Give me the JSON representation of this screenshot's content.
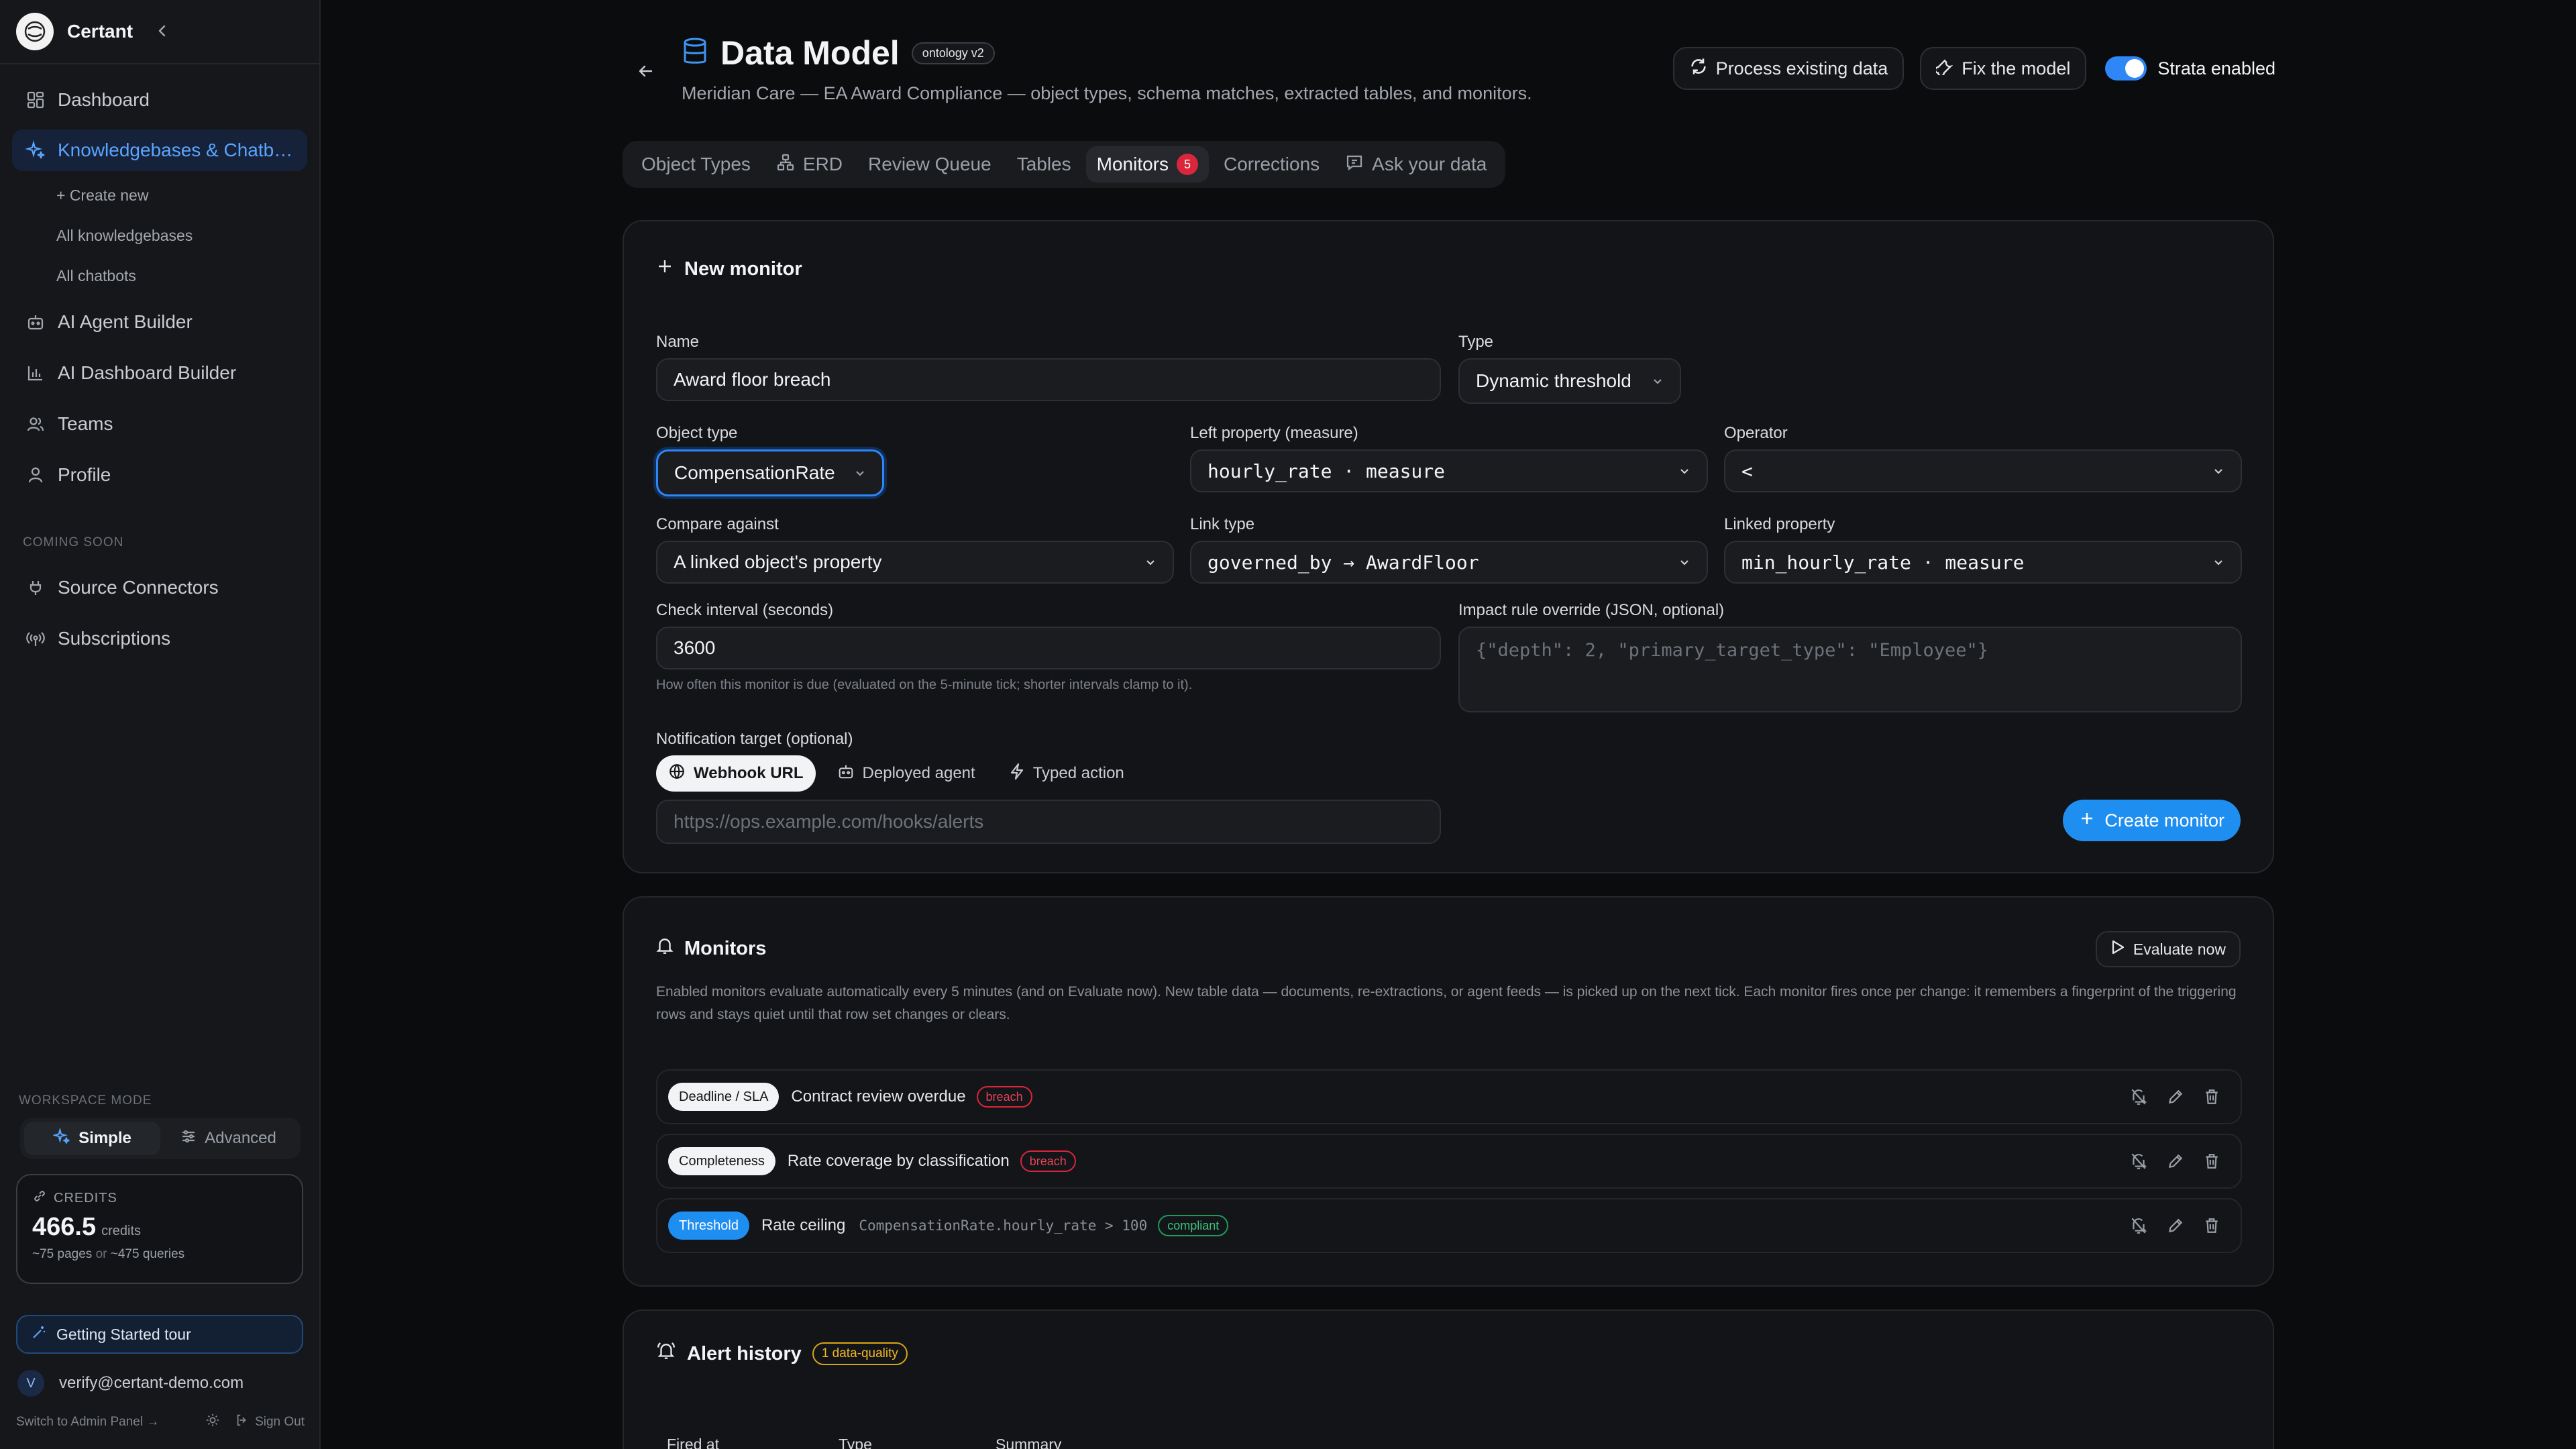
{
  "sidebar": {
    "brand": "Certant",
    "nav": [
      {
        "label": "Dashboard"
      },
      {
        "label": "Knowledgebases & Chatb…"
      },
      {
        "label": "AI Agent Builder"
      },
      {
        "label": "AI Dashboard Builder"
      },
      {
        "label": "Teams"
      },
      {
        "label": "Profile"
      },
      {
        "label": "Source Connectors"
      },
      {
        "label": "Subscriptions"
      }
    ],
    "sub_items": [
      "+ Create new",
      "All knowledgebases",
      "All chatbots"
    ],
    "coming_soon_label": "COMING SOON",
    "workspace_mode_label": "WORKSPACE MODE",
    "mode_simple": "Simple",
    "mode_advanced": "Advanced",
    "credits": {
      "label": "CREDITS",
      "value": "466.5",
      "unit": "credits",
      "pages": "~75 pages",
      "or": "or",
      "queries": "~475 queries"
    },
    "tour_label": "Getting Started tour",
    "user_initial": "V",
    "user_email": "verify@certant-demo.com",
    "switch_admin": "Switch to Admin Panel →",
    "sign_out": "Sign Out"
  },
  "header": {
    "title": "Data Model",
    "version_badge": "ontology v2",
    "subtitle": "Meridian Care — EA Award Compliance — object types, schema matches, extracted tables, and monitors.",
    "process_btn": "Process existing data",
    "fix_btn": "Fix the model",
    "strata_label": "Strata enabled"
  },
  "tabs": [
    {
      "label": "Object Types"
    },
    {
      "label": "ERD"
    },
    {
      "label": "Review Queue"
    },
    {
      "label": "Tables"
    },
    {
      "label": "Monitors",
      "count": "5"
    },
    {
      "label": "Corrections"
    },
    {
      "label": "Ask your data"
    }
  ],
  "new_monitor": {
    "heading": "New monitor",
    "name_label": "Name",
    "name_value": "Award floor breach",
    "type_label": "Type",
    "type_value": "Dynamic threshold",
    "object_type_label": "Object type",
    "object_type_value": "CompensationRate",
    "left_prop_label": "Left property (measure)",
    "left_prop_value": "hourly_rate · measure",
    "operator_label": "Operator",
    "operator_value": "<",
    "compare_label": "Compare against",
    "compare_value": "A linked object's property",
    "link_type_label": "Link type",
    "link_type_value": "governed_by → AwardFloor",
    "linked_prop_label": "Linked property",
    "linked_prop_value": "min_hourly_rate · measure",
    "interval_label": "Check interval (seconds)",
    "interval_value": "3600",
    "interval_help": "How often this monitor is due (evaluated on the 5-minute tick; shorter intervals clamp to it).",
    "impact_label": "Impact rule override (JSON, optional)",
    "impact_placeholder": "{\"depth\": 2, \"primary_target_type\": \"Employee\"}",
    "notif_label": "Notification target (optional)",
    "notif_webhook": "Webhook URL",
    "notif_agent": "Deployed agent",
    "notif_action": "Typed action",
    "webhook_placeholder": "https://ops.example.com/hooks/alerts",
    "create_btn": "Create monitor"
  },
  "monitors": {
    "heading": "Monitors",
    "evaluate_btn": "Evaluate now",
    "description": "Enabled monitors evaluate automatically every 5 minutes (and on Evaluate now). New table data — documents, re-extractions, or agent feeds — is picked up on the next tick. Each monitor fires once per change: it remembers a fingerprint of the triggering rows and stays quiet until that row set changes or clears.",
    "rows": [
      {
        "kind": "Deadline / SLA",
        "name": "Contract review overdue",
        "expr": "",
        "status": "breach"
      },
      {
        "kind": "Completeness",
        "name": "Rate coverage by classification",
        "expr": "",
        "status": "breach"
      },
      {
        "kind": "Threshold",
        "name": "Rate ceiling",
        "expr": "CompensationRate.hourly_rate > 100",
        "status": "compliant"
      }
    ]
  },
  "alert_history": {
    "heading": "Alert history",
    "badge": "1 data-quality",
    "columns": [
      "Fired at",
      "Type",
      "Summary"
    ]
  },
  "colors": {
    "accent": "#1f8ef1",
    "breach": "#d9263a",
    "compliant": "#1f9a5a",
    "warning": "#d9a514"
  }
}
